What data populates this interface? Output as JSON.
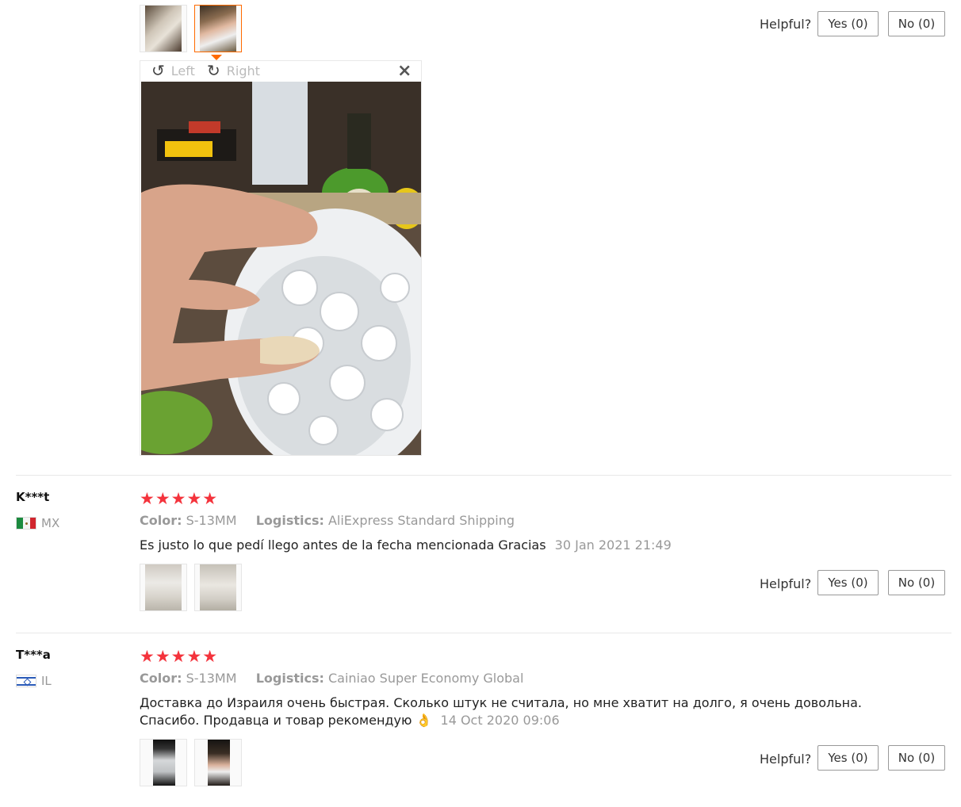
{
  "helpful": {
    "label": "Helpful?",
    "yes": "Yes (0)",
    "no": "No (0)"
  },
  "viewer": {
    "left_label": "Left",
    "right_label": "Right",
    "left_icon": "rotate-left-icon",
    "right_icon": "rotate-right-icon",
    "close_icon": "close-icon",
    "close_glyph": "×",
    "left_glyph": "↺",
    "right_glyph": "↻"
  },
  "reviews": [
    {
      "user": "K***t",
      "country": "MX",
      "stars": "★★★★★",
      "color_label": "Color:",
      "color_value": "S-13MM",
      "logistics_label": "Logistics:",
      "logistics_value": "AliExpress Standard Shipping",
      "text": "Es justo lo que pedí llego antes de la fecha mencionada Gracias",
      "date": "30 Jan 2021 21:49"
    },
    {
      "user": "T***a",
      "country": "IL",
      "stars": "★★★★★",
      "color_label": "Color:",
      "color_value": "S-13MM",
      "logistics_label": "Logistics:",
      "logistics_value": "Cainiao Super Economy Global",
      "text_line1": "Доставка до Израиля очень быстрая. Сколько штук не считала, но мне хватит на долго, я очень довольна.",
      "text_line2": "Спасибо. Продавца и товар рекомендую 👌",
      "date": "14 Oct 2020 09:06"
    }
  ],
  "colors": {
    "star": "#f4333c",
    "accent": "#ff6a00",
    "muted": "#999999"
  }
}
